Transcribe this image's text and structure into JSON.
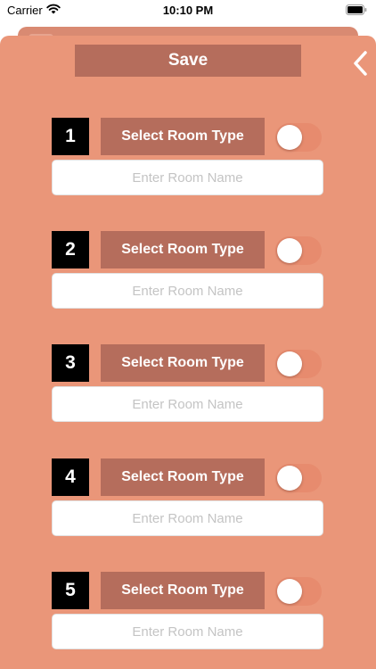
{
  "status_bar": {
    "carrier": "Carrier",
    "time": "10:10 PM"
  },
  "toolbar": {
    "save_label": "Save",
    "back_icon": "chevron-left-icon"
  },
  "rooms": [
    {
      "number": "1",
      "type_label": "Select Room Type",
      "name_value": "",
      "name_placeholder": "Enter Room Name",
      "toggle_on": false
    },
    {
      "number": "2",
      "type_label": "Select Room Type",
      "name_value": "",
      "name_placeholder": "Enter Room Name",
      "toggle_on": false
    },
    {
      "number": "3",
      "type_label": "Select Room Type",
      "name_value": "",
      "name_placeholder": "Enter Room Name",
      "toggle_on": false
    },
    {
      "number": "4",
      "type_label": "Select Room Type",
      "name_value": "",
      "name_placeholder": "Enter Room Name",
      "toggle_on": false
    },
    {
      "number": "5",
      "type_label": "Select Room Type",
      "name_value": "",
      "name_placeholder": "Enter Room Name",
      "toggle_on": false
    }
  ],
  "colors": {
    "sheet_background": "#ea9679",
    "button_background": "#b56d5c",
    "number_badge": "#000000",
    "toggle_off_track": "#e78b6e"
  }
}
